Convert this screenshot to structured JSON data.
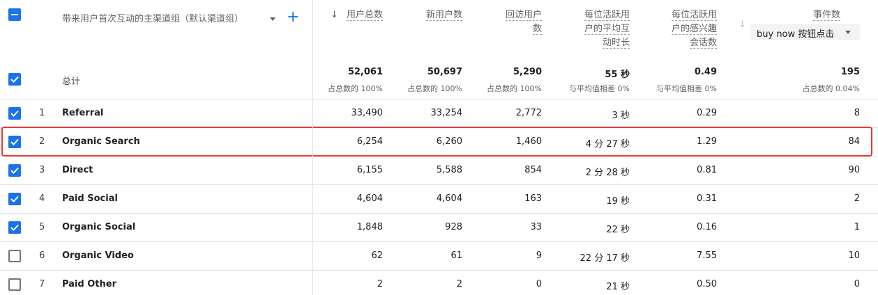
{
  "header": {
    "dimension_label": "带来用户首次互动的主渠道组（默认渠道组）",
    "add_icon": "+",
    "columns": [
      {
        "line1": "用户总数",
        "sorted": true
      },
      {
        "line1": "新用户数"
      },
      {
        "line1": "回访用户",
        "line2": "数"
      },
      {
        "line1": "每位活跃用",
        "line2": "户的平均互",
        "line3": "动时长"
      },
      {
        "line1": "每位活跃用",
        "line2": "户的感兴趣",
        "line3": "会话数"
      },
      {
        "line1": "事件数"
      }
    ],
    "event_selector": "buy now 按钮点击",
    "sort_arrow_active": "↓",
    "sort_arrow_inactive": "↓"
  },
  "totals": {
    "label": "总计",
    "values": [
      "52,061",
      "50,697",
      "5,290",
      "55 秒",
      "0.49",
      "195"
    ],
    "subs": [
      "占总数的 100%",
      "占总数的 100%",
      "占总数的 100%",
      "与平均值相差 0%",
      "与平均值相差 0%",
      "占总数的 0.04%"
    ]
  },
  "rows": [
    {
      "idx": "1",
      "name": "Referral",
      "checked": true,
      "values": [
        "33,490",
        "33,254",
        "2,772",
        "3 秒",
        "0.29",
        "8"
      ]
    },
    {
      "idx": "2",
      "name": "Organic Search",
      "checked": true,
      "highlighted": true,
      "values": [
        "6,254",
        "6,260",
        "1,460",
        "4 分 27 秒",
        "1.29",
        "84"
      ]
    },
    {
      "idx": "3",
      "name": "Direct",
      "checked": true,
      "values": [
        "6,155",
        "5,588",
        "854",
        "2 分 28 秒",
        "0.81",
        "90"
      ]
    },
    {
      "idx": "4",
      "name": "Paid Social",
      "checked": true,
      "values": [
        "4,604",
        "4,604",
        "163",
        "19 秒",
        "0.31",
        "2"
      ]
    },
    {
      "idx": "5",
      "name": "Organic Social",
      "checked": true,
      "values": [
        "1,848",
        "928",
        "33",
        "22 秒",
        "0.16",
        "1"
      ]
    },
    {
      "idx": "6",
      "name": "Organic Video",
      "checked": false,
      "values": [
        "62",
        "61",
        "9",
        "22 分 17 秒",
        "7.55",
        "10"
      ]
    },
    {
      "idx": "7",
      "name": "Paid Other",
      "checked": false,
      "values": [
        "2",
        "2",
        "0",
        "21 秒",
        "0.50",
        "0"
      ]
    }
  ],
  "colors": {
    "accent": "#1a73e8",
    "highlight": "#e53935",
    "border": "#e0e0e0"
  }
}
